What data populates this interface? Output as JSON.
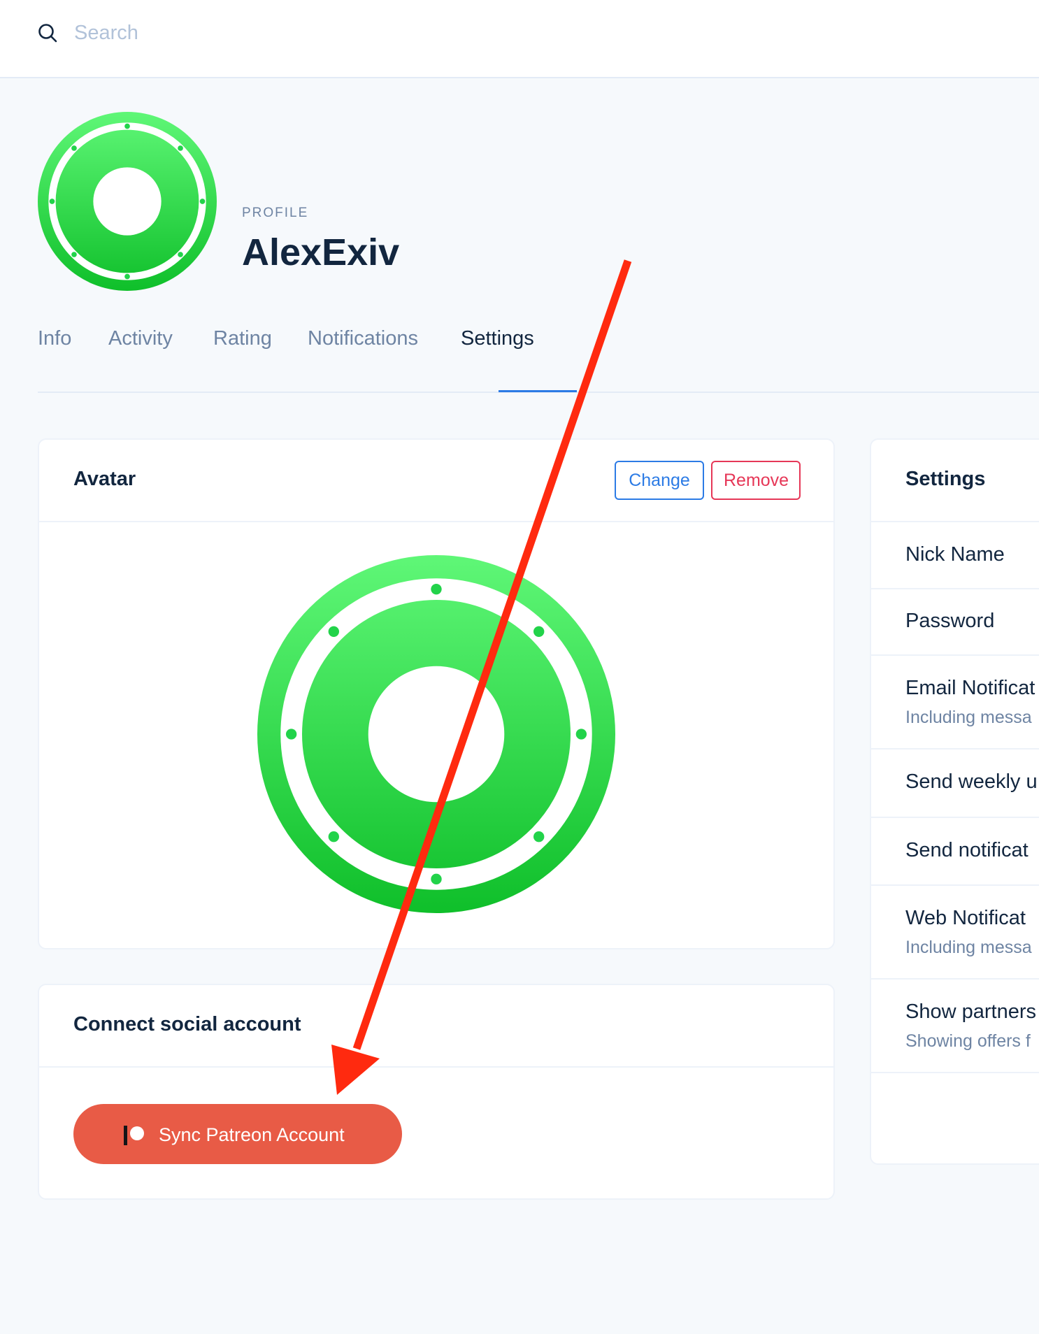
{
  "search": {
    "placeholder": "Search"
  },
  "header": {
    "pretitle": "PROFILE",
    "title": "AlexExiv"
  },
  "tabs": [
    {
      "label": "Info"
    },
    {
      "label": "Activity"
    },
    {
      "label": "Rating"
    },
    {
      "label": "Notifications"
    },
    {
      "label": "Settings",
      "active": true
    }
  ],
  "avatar_card": {
    "title": "Avatar",
    "change_label": "Change",
    "remove_label": "Remove"
  },
  "social_card": {
    "title": "Connect social account",
    "patreon_label": "Sync Patreon Account"
  },
  "settings_card": {
    "title": "Settings",
    "rows": [
      {
        "label": "Nick Name"
      },
      {
        "label": "Password"
      },
      {
        "label": "Email Notificat",
        "sub": "Including messa"
      },
      {
        "label": "Send weekly u"
      },
      {
        "label": "Send notificat"
      },
      {
        "label": "Web Notificat",
        "sub": "Including messa"
      },
      {
        "label": "Show partners",
        "sub": "Showing offers f"
      }
    ]
  },
  "colors": {
    "primary": "#2c7be5",
    "danger": "#e63757",
    "patreon": "#e85b46",
    "annotation_arrow": "#ff2a0f",
    "avatar_green": "#22d34a"
  },
  "icons": [
    "search-icon",
    "patreon-icon",
    "avatar-logo-icon"
  ]
}
